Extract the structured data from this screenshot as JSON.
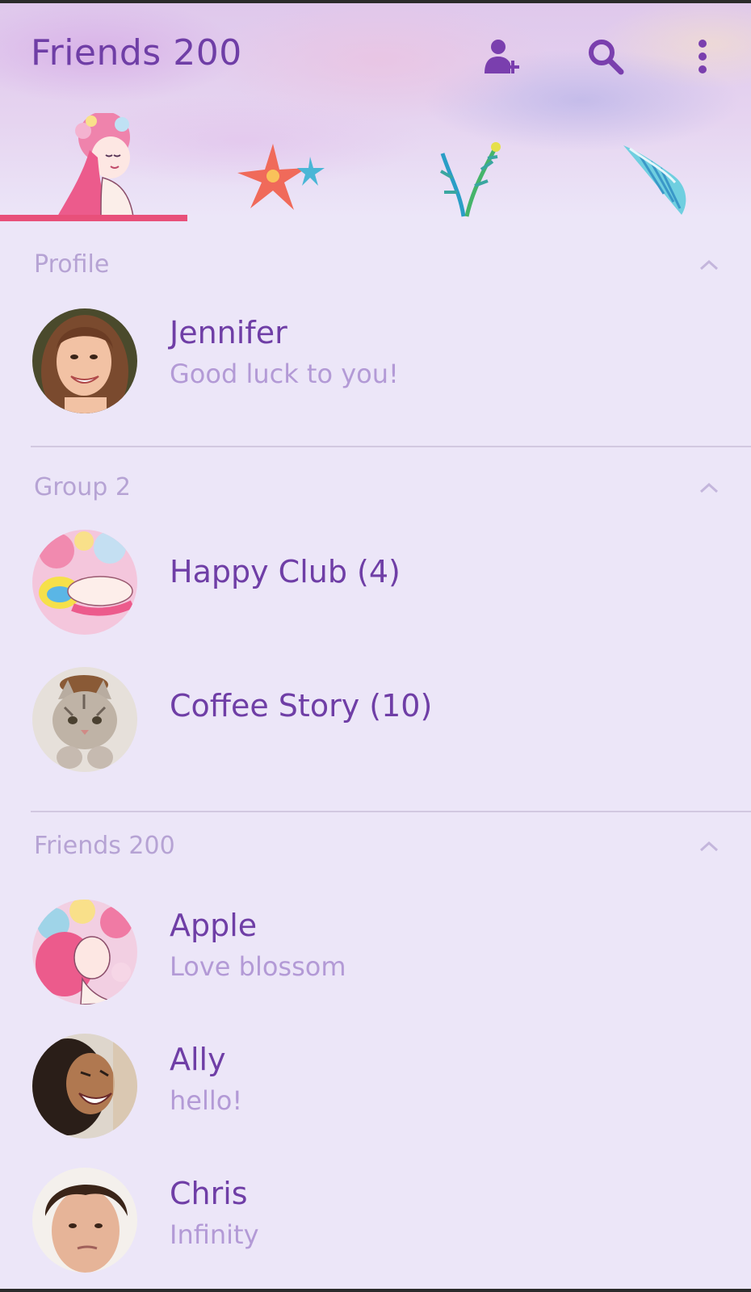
{
  "header": {
    "title": "Friends 200",
    "icons": {
      "add_friend": "add-friend-icon",
      "search": "search-icon",
      "more": "more-vertical-icon"
    }
  },
  "tabs": [
    {
      "id": "friends",
      "icon": "mermaid-icon",
      "active": true
    },
    {
      "id": "chats",
      "icon": "starfish-icon",
      "active": false
    },
    {
      "id": "timeline",
      "icon": "seaweed-icon",
      "active": false
    },
    {
      "id": "more",
      "icon": "seashell-icon",
      "active": false
    }
  ],
  "sections": {
    "profile": {
      "title": "Profile",
      "items": [
        {
          "name": "Jennifer",
          "status": "Good luck to you!",
          "avatar": "woman-photo"
        }
      ]
    },
    "groups": {
      "title": "Group 2",
      "items": [
        {
          "name": "Happy Club (4)",
          "avatar": "mermaid-art"
        },
        {
          "name": "Coffee Story (10)",
          "avatar": "cat-photo"
        }
      ]
    },
    "friends": {
      "title": "Friends 200",
      "items": [
        {
          "name": "Apple",
          "status": "Love blossom",
          "avatar": "mermaid-art"
        },
        {
          "name": "Ally",
          "status": "hello!",
          "avatar": "laughing-woman-photo"
        },
        {
          "name": "Chris",
          "status": "Infinity",
          "avatar": "young-man-photo"
        }
      ]
    }
  },
  "colors": {
    "accent": "#6f3ea6",
    "section_title": "#b6a3d4",
    "status_text": "#b39ad6",
    "tab_indicator": "#e8507a",
    "background": "#ece6f8"
  }
}
